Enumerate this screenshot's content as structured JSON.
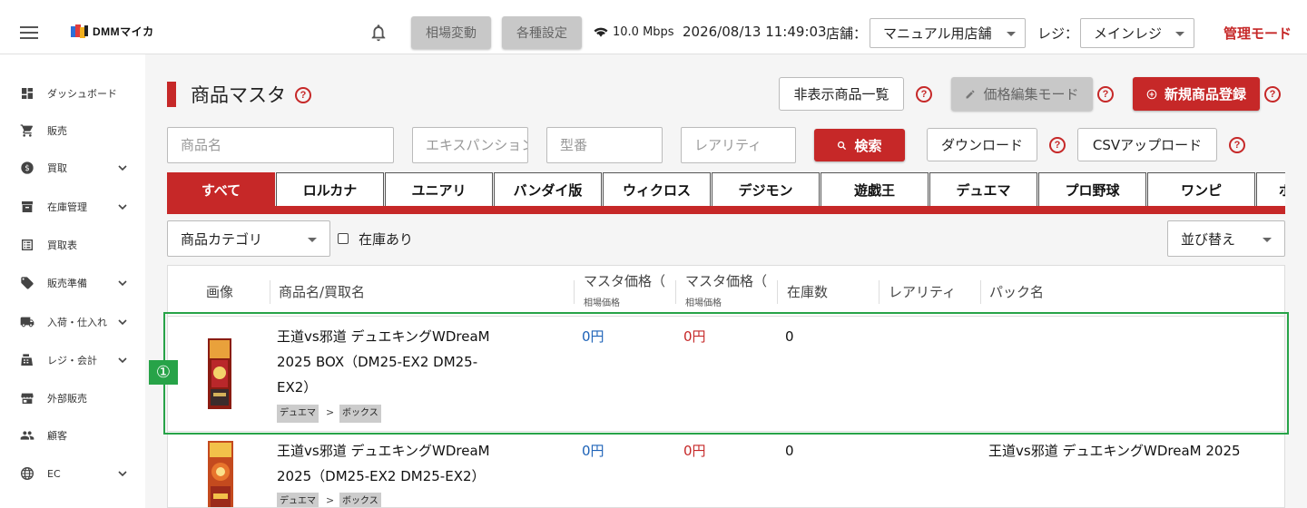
{
  "header": {
    "logo_text": "DMMマイカ",
    "market_change": "相場変動",
    "settings": "各種設定",
    "network_speed": "10.0 Mbps",
    "datetime": "2026/08/13 11:49:03",
    "store_label": "店舗：",
    "store_value": "マニュアル用店舗",
    "register_label": "レジ：",
    "register_value": "メインレジ",
    "admin_mode": "管理モード"
  },
  "sidebar": {
    "items": [
      {
        "label": "ダッシュボード",
        "icon": "dashboard-icon"
      },
      {
        "label": "販売",
        "icon": "cart-icon"
      },
      {
        "label": "買取",
        "icon": "dollar-icon"
      },
      {
        "label": "在庫管理",
        "icon": "archive-icon"
      },
      {
        "label": "買取表",
        "icon": "list-icon"
      },
      {
        "label": "販売準備",
        "icon": "tag-icon"
      },
      {
        "label": "入荷・仕入れ",
        "icon": "truck-icon"
      },
      {
        "label": "レジ・会計",
        "icon": "register-icon"
      },
      {
        "label": "外部販売",
        "icon": "store-icon"
      },
      {
        "label": "顧客",
        "icon": "people-icon"
      },
      {
        "label": "EC",
        "icon": "globe-icon"
      }
    ]
  },
  "page": {
    "title": "商品マスタ",
    "hidden_products": "非表示商品一覧",
    "price_edit_mode": "価格編集モード",
    "new_product": "新規商品登録",
    "search_button": "検索",
    "download": "ダウンロード",
    "csv_upload": "CSVアップロード"
  },
  "search": {
    "name_placeholder": "商品名",
    "expansion_placeholder": "エキスパンション",
    "model_placeholder": "型番",
    "rarity_placeholder": "レアリティ"
  },
  "tabs": [
    "すべて",
    "ロルカナ",
    "ユニアリ",
    "バンダイ版",
    "ウィクロス",
    "デジモン",
    "遊戯王",
    "デュエマ",
    "プロ野球",
    "ワンピ",
    "ポ"
  ],
  "filters": {
    "category": "商品カテゴリ",
    "in_stock": "在庫あり",
    "sort": "並び替え"
  },
  "table": {
    "columns": {
      "image": "画像",
      "name": "商品名/買取名",
      "master_price_1": "マスタ価格（",
      "master_price_1_sub": "相場価格",
      "master_price_2": "マスタ価格（",
      "master_price_2_sub": "相場価格",
      "stock": "在庫数",
      "rarity": "レアリティ",
      "pack": "パック名"
    },
    "rows": [
      {
        "name_line1": "王道vs邪道 デュエキングWDreaM",
        "name_line2": "2025 BOX（DM25-EX2 DM25-",
        "name_line3": "EX2）",
        "tag1": "デュエマ",
        "tag_sep": ">",
        "tag2": "ボックス",
        "price1": "0円",
        "price2": "0円",
        "stock": "0",
        "rarity": "",
        "pack": ""
      },
      {
        "name_line1": "王道vs邪道 デュエキングWDreaM",
        "name_line2": "2025（DM25-EX2 DM25-EX2）",
        "name_line3": "",
        "tag1": "デュエマ",
        "tag_sep": ">",
        "tag2": "ボックス",
        "price1": "0円",
        "price2": "0円",
        "stock": "0",
        "rarity": "",
        "pack": "王道vs邪道 デュエキングWDreaM 2025"
      }
    ]
  },
  "annotation": {
    "marker": "①"
  },
  "colors": {
    "accent": "#c62828",
    "price_blue": "#1e63b8",
    "highlight": "#27a348"
  }
}
